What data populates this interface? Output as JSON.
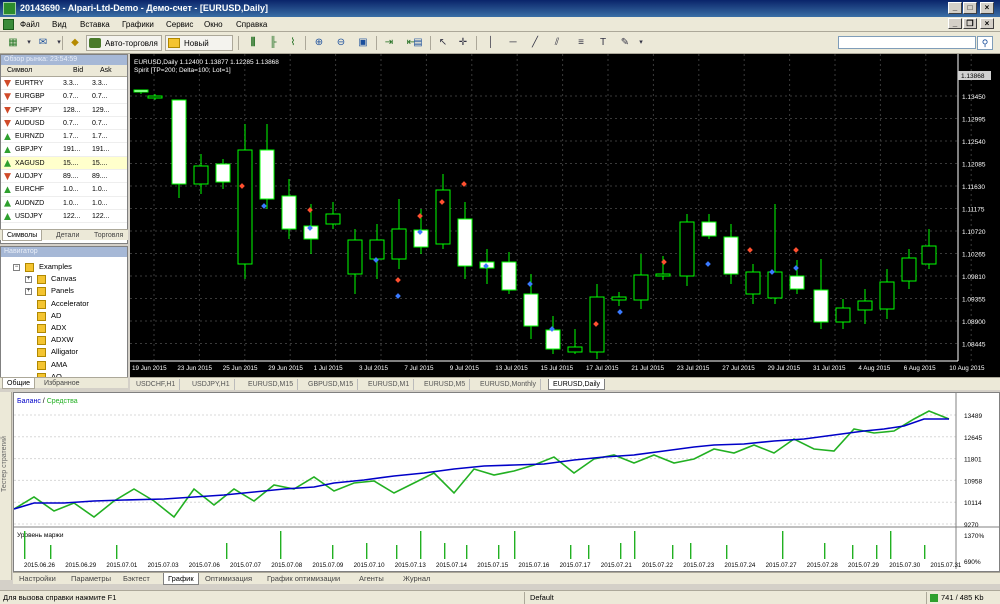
{
  "window": {
    "title": "20143690 - Alpari-Ltd-Demo - Демо-счет - [EURUSD,Daily]"
  },
  "menu": [
    "Файл",
    "Вид",
    "Вставка",
    "Графики",
    "Сервис",
    "Окно",
    "Справка"
  ],
  "toolbar": {
    "autotrade_label": "Авто-торговля",
    "neworder_label": "Новый ордер",
    "search_placeholder": ""
  },
  "market_watch": {
    "title": "Обзор рынка: 23:54:59",
    "columns": {
      "symbol": "Символ",
      "bid": "Bid",
      "ask": "Ask"
    },
    "rows": [
      {
        "symbol": "EURTRY",
        "bid": "3.3...",
        "ask": "3.3...",
        "dir": "down"
      },
      {
        "symbol": "EURGBP",
        "bid": "0.7...",
        "ask": "0.7...",
        "dir": "down"
      },
      {
        "symbol": "CHFJPY",
        "bid": "128...",
        "ask": "129...",
        "dir": "down"
      },
      {
        "symbol": "AUDUSD",
        "bid": "0.7...",
        "ask": "0.7...",
        "dir": "down"
      },
      {
        "symbol": "EURNZD",
        "bid": "1.7...",
        "ask": "1.7...",
        "dir": "up"
      },
      {
        "symbol": "GBPJPY",
        "bid": "191...",
        "ask": "191...",
        "dir": "up"
      },
      {
        "symbol": "XAGUSD",
        "bid": "15....",
        "ask": "15....",
        "dir": "up"
      },
      {
        "symbol": "AUDJPY",
        "bid": "89....",
        "ask": "89....",
        "dir": "down"
      },
      {
        "symbol": "EURCHF",
        "bid": "1.0...",
        "ask": "1.0...",
        "dir": "up"
      },
      {
        "symbol": "AUDNZD",
        "bid": "1.0...",
        "ask": "1.0...",
        "dir": "up"
      },
      {
        "symbol": "USDJPY",
        "bid": "122...",
        "ask": "122...",
        "dir": "up"
      }
    ],
    "tabs": [
      "Символы",
      "Детали",
      "Торговля"
    ]
  },
  "navigator": {
    "title": "Навигатор",
    "items": [
      {
        "label": "Examples",
        "level": 0,
        "expander": "−"
      },
      {
        "label": "Canvas",
        "level": 1,
        "expander": "+"
      },
      {
        "label": "Panels",
        "level": 1,
        "expander": "+"
      },
      {
        "label": "Accelerator",
        "level": 1,
        "expander": ""
      },
      {
        "label": "AD",
        "level": 1,
        "expander": ""
      },
      {
        "label": "ADX",
        "level": 1,
        "expander": ""
      },
      {
        "label": "ADXW",
        "level": 1,
        "expander": ""
      },
      {
        "label": "Alligator",
        "level": 1,
        "expander": ""
      },
      {
        "label": "AMA",
        "level": 1,
        "expander": ""
      },
      {
        "label": "AO",
        "level": 1,
        "expander": ""
      }
    ],
    "tabs": [
      "Общие",
      "Избранное"
    ]
  },
  "chart": {
    "info_line1": "EURUSD,Daily  1.12400 1.13877 1.12285 1.13868",
    "info_line2": "Spirit [TP=200; Delta=100; Lot=1]",
    "price_current": "1.13868",
    "price_labels": [
      "1.13450",
      "1.12995",
      "1.12540",
      "1.12085",
      "1.11630",
      "1.11175",
      "1.10720",
      "1.10265",
      "1.09810",
      "1.09355",
      "1.08900",
      "1.08445"
    ],
    "date_labels": [
      "19 Jun 2015",
      "23 Jun 2015",
      "25 Jun 2015",
      "29 Jun 2015",
      "1 Jul 2015",
      "3 Jul 2015",
      "7 Jul 2015",
      "9 Jul 2015",
      "13 Jul 2015",
      "15 Jul 2015",
      "17 Jul 2015",
      "21 Jul 2015",
      "23 Jul 2015",
      "27 Jul 2015",
      "29 Jul 2015",
      "31 Jul 2015",
      "4 Aug 2015",
      "6 Aug 2015",
      "10 Aug 2015"
    ],
    "tabs": [
      "USDCHF,H1",
      "USDJPY,H1",
      "EURUSD,M15",
      "GBPUSD,M15",
      "EURUSD,M1",
      "EURUSD,M5",
      "EURUSD,Monthly",
      "EURUSD,Daily"
    ],
    "colors": {
      "bg": "#000000",
      "bull": "#00ff00",
      "body_fill": "#ffffff",
      "grid": "#404040"
    }
  },
  "tester": {
    "side_label": "Тестер стратегий",
    "legend_balance": "Баланс",
    "legend_sep": " / ",
    "legend_equity": "Средства",
    "balance_y_labels": [
      "13489",
      "12645",
      "11801",
      "10958",
      "10114",
      "9270"
    ],
    "margin_title": "Уровень маржи",
    "margin_y_labels": [
      "1370%",
      "690%"
    ],
    "date_labels": [
      "2015.06.26",
      "2015.06.29",
      "2015.07.01",
      "2015.07.03",
      "2015.07.06",
      "2015.07.07",
      "2015.07.08",
      "2015.07.09",
      "2015.07.10",
      "2015.07.13",
      "2015.07.14",
      "2015.07.15",
      "2015.07.16",
      "2015.07.17",
      "2015.07.21",
      "2015.07.22",
      "2015.07.23",
      "2015.07.24",
      "2015.07.27",
      "2015.07.28",
      "2015.07.29",
      "2015.07.30",
      "2015.07.31"
    ],
    "colors": {
      "balance": "#0000c8",
      "equity": "#22b022",
      "margin": "#22b022"
    },
    "tabs": [
      "Настройки",
      "Параметры",
      "Бэктест",
      "График",
      "Оптимизация",
      "График оптимизации",
      "Агенты",
      "Журнал"
    ],
    "active_tab": "График"
  },
  "status": {
    "help": "Для вызова справки нажмите F1",
    "profile": "Default",
    "traffic": "741 / 485 Kb"
  }
}
